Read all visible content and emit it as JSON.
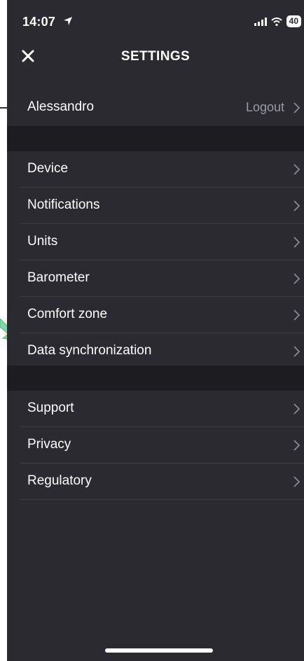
{
  "status_bar": {
    "time": "14:07",
    "battery": "40"
  },
  "nav": {
    "title": "SETTINGS"
  },
  "account": {
    "name": "Alessandro",
    "logout_label": "Logout"
  },
  "section1": [
    {
      "label": "Device"
    },
    {
      "label": "Notifications"
    },
    {
      "label": "Units"
    },
    {
      "label": "Barometer"
    },
    {
      "label": "Comfort zone"
    },
    {
      "label": "Data synchronization"
    }
  ],
  "section2": [
    {
      "label": "Support"
    },
    {
      "label": "Privacy"
    },
    {
      "label": "Regulatory"
    }
  ],
  "colors": {
    "background": "#2a2a30",
    "section_gap": "#1d1d21",
    "text": "#ffffff",
    "secondary_text": "#9a9aa2",
    "callout_arrow": "#7fd6a8"
  }
}
